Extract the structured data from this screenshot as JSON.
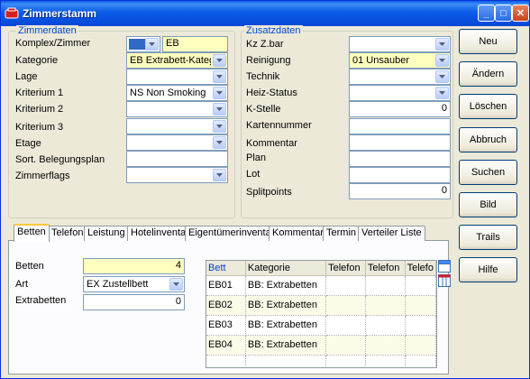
{
  "window": {
    "title": "Zimmerstamm",
    "minimize": "_",
    "maximize": "□",
    "close": "✕"
  },
  "zimmerdaten": {
    "title": "Zimmerdaten",
    "komplex_label": "Komplex/Zimmer",
    "komplex_value": "EB",
    "kategorie_label": "Kategorie",
    "kategorie_value": "EB Extrabett-Kategor",
    "lage_label": "Lage",
    "lage_value": "",
    "kriterium1_label": "Kriterium 1",
    "kriterium1_value": "NS Non Smoking",
    "kriterium2_label": "Kriterium 2",
    "kriterium2_value": "",
    "kriterium3_label": "Kriterium 3",
    "kriterium3_value": "",
    "etage_label": "Etage",
    "etage_value": "",
    "sort_label": "Sort. Belegungsplan",
    "sort_value": "",
    "flags_label": "Zimmerflags",
    "flags_value": ""
  },
  "zusatzdaten": {
    "title": "Zusatzdaten",
    "kz_label": "Kz Z.bar",
    "kz_value": "",
    "reinigung_label": "Reinigung",
    "reinigung_value": "01 Unsauber",
    "technik_label": "Technik",
    "technik_value": "",
    "heiz_label": "Heiz-Status",
    "heiz_value": "",
    "kstelle_label": "K-Stelle",
    "kstelle_value": "0",
    "karten_label": "Kartennummer",
    "karten_value": "",
    "kommentar_label": "Kommentar",
    "kommentar_value": "",
    "plan_label": "Plan",
    "plan_value": "",
    "lot_label": "Lot",
    "lot_value": "",
    "split_label": "Splitpoints",
    "split_value": "0"
  },
  "buttons": {
    "neu": "Neu",
    "aendern": "Ändern",
    "loeschen": "Löschen",
    "abbruch": "Abbruch",
    "suchen": "Suchen",
    "bild": "Bild",
    "trails": "Trails",
    "hilfe": "Hilfe"
  },
  "tabs": [
    "Betten",
    "Telefon",
    "Leistung",
    "Hotelinventar",
    "Eigentümerinventar",
    "Kommentar",
    "Termin",
    "Verteiler Liste"
  ],
  "betten": {
    "betten_label": "Betten",
    "betten_value": "4",
    "art_label": "Art",
    "art_value": "EX  Zustellbett",
    "extra_label": "Extrabetten",
    "extra_value": "0"
  },
  "grid": {
    "columns": [
      "Bett",
      "Kategorie",
      "Telefon",
      "Telefon",
      "Telefo"
    ],
    "rows": [
      [
        "EB01",
        "BB: Extrabetten",
        "",
        "",
        ""
      ],
      [
        "EB02",
        "BB: Extrabetten",
        "",
        "",
        ""
      ],
      [
        "EB03",
        "BB: Extrabetten",
        "",
        "",
        ""
      ],
      [
        "EB04",
        "BB: Extrabetten",
        "",
        "",
        ""
      ]
    ]
  },
  "colors": {
    "accent": "#0046d5",
    "titlebar": "#0a5ce8",
    "highlight_field": "#ffffc0",
    "window_bg": "#ece9d8"
  }
}
